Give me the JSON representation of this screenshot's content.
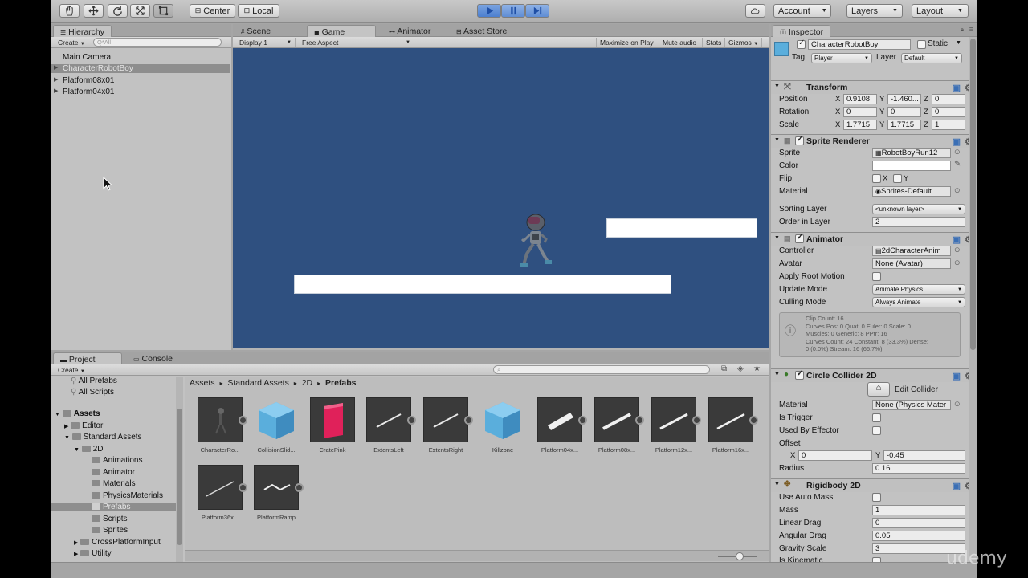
{
  "toolbar": {
    "center_label": "Center",
    "local_label": "Local",
    "account_label": "Account",
    "layers_label": "Layers",
    "layout_label": "Layout"
  },
  "hierarchy": {
    "tab_label": "Hierarchy",
    "create_label": "Create",
    "search_placeholder": "Q*All",
    "items": [
      {
        "label": "Main Camera"
      },
      {
        "label": "CharacterRobotBoy"
      },
      {
        "label": "Platform08x01"
      },
      {
        "label": "Platform04x01"
      }
    ]
  },
  "view_tabs": {
    "scene": "Scene",
    "game": "Game",
    "animator": "Animator",
    "asset_store": "Asset Store"
  },
  "game_bar": {
    "display": "Display 1",
    "aspect": "Free Aspect",
    "maximize": "Maximize on Play",
    "mute": "Mute audio",
    "stats": "Stats",
    "gizmos": "Gizmos"
  },
  "project": {
    "tab_label": "Project",
    "console_label": "Console",
    "create_label": "Create",
    "favorites": [
      {
        "label": "All Prefabs"
      },
      {
        "label": "All Scripts"
      }
    ],
    "tree": [
      {
        "label": "Assets"
      },
      {
        "label": "Editor"
      },
      {
        "label": "Standard Assets"
      },
      {
        "label": "2D"
      },
      {
        "label": "Animations"
      },
      {
        "label": "Animator"
      },
      {
        "label": "Materials"
      },
      {
        "label": "PhysicsMaterials"
      },
      {
        "label": "Prefabs"
      },
      {
        "label": "Scripts"
      },
      {
        "label": "Sprites"
      },
      {
        "label": "CrossPlatformInput"
      },
      {
        "label": "Utility"
      }
    ],
    "breadcrumb": [
      "Assets",
      "Standard Assets",
      "2D",
      "Prefabs"
    ],
    "assets": [
      {
        "label": "CharacterRo...",
        "icon": "robot-icon"
      },
      {
        "label": "CollisionSlid...",
        "icon": "cube-icon"
      },
      {
        "label": "CratePink",
        "icon": "crate-icon"
      },
      {
        "label": "ExtentsLeft",
        "icon": "line-icon"
      },
      {
        "label": "ExtentsRight",
        "icon": "line-icon"
      },
      {
        "label": "Killzone",
        "icon": "cube-icon"
      },
      {
        "label": "Platform04x...",
        "icon": "platform-icon"
      },
      {
        "label": "Platform08x...",
        "icon": "line-icon"
      },
      {
        "label": "Platform12x...",
        "icon": "line-icon"
      },
      {
        "label": "Platform16x...",
        "icon": "line-icon"
      },
      {
        "label": "Platform36x...",
        "icon": "line-icon"
      },
      {
        "label": "PlatformRamp",
        "icon": "ramp-icon"
      }
    ]
  },
  "inspector": {
    "tab_label": "Inspector",
    "object_name": "CharacterRobotBoy",
    "static_label": "Static",
    "tag_label": "Tag",
    "tag_value": "Player",
    "layer_label": "Layer",
    "layer_value": "Default",
    "transform": {
      "title": "Transform",
      "position_label": "Position",
      "position": {
        "x": "0.9108",
        "y": "-1.460...",
        "z": "0"
      },
      "rotation_label": "Rotation",
      "rotation": {
        "x": "0",
        "y": "0",
        "z": "0"
      },
      "scale_label": "Scale",
      "scale": {
        "x": "1.7715",
        "y": "1.7715",
        "z": "1"
      }
    },
    "sprite_renderer": {
      "title": "Sprite Renderer",
      "sprite_label": "Sprite",
      "sprite_value": "RobotBoyRun12",
      "color_label": "Color",
      "flip_label": "Flip",
      "flip_x": "X",
      "flip_y": "Y",
      "material_label": "Material",
      "material_value": "Sprites-Default",
      "sorting_layer_label": "Sorting Layer",
      "sorting_layer_value": "<unknown layer>",
      "order_label": "Order in Layer",
      "order_value": "2"
    },
    "animator": {
      "title": "Animator",
      "controller_label": "Controller",
      "controller_value": "2dCharacterAnim",
      "avatar_label": "Avatar",
      "avatar_value": "None (Avatar)",
      "root_motion_label": "Apply Root Motion",
      "update_mode_label": "Update Mode",
      "update_mode_value": "Animate Physics",
      "culling_mode_label": "Culling Mode",
      "culling_mode_value": "Always Animate",
      "info_lines": [
        "Clip Count: 16",
        "Curves Pos: 0 Quat: 0 Euler: 0 Scale: 0",
        "Muscles: 0 Generic: 8 PPtr: 16",
        "Curves Count: 24 Constant: 8 (33.3%) Dense:",
        "0 (0.0%) Stream: 16 (66.7%)"
      ]
    },
    "circle_collider": {
      "title": "Circle Collider 2D",
      "edit_label": "Edit Collider",
      "material_label": "Material",
      "material_value": "None (Physics Mater",
      "trigger_label": "Is Trigger",
      "effector_label": "Used By Effector",
      "offset_label": "Offset",
      "offset": {
        "x": "0",
        "y": "-0.45"
      },
      "radius_label": "Radius",
      "radius_value": "0.16"
    },
    "rigidbody": {
      "title": "Rigidbody 2D",
      "auto_mass_label": "Use Auto Mass",
      "mass_label": "Mass",
      "mass_value": "1",
      "linear_drag_label": "Linear Drag",
      "linear_drag_value": "0",
      "angular_drag_label": "Angular Drag",
      "angular_drag_value": "0.05",
      "gravity_label": "Gravity Scale",
      "gravity_value": "3",
      "kinematic_label": "Is Kinematic"
    }
  },
  "watermark": "udemy",
  "colors": {
    "game_bg": "#2f5080",
    "editor_bg": "#c2c2c2",
    "play_active": "#4c7fcf",
    "crate": "#e0215a",
    "cube": "#5aaedc"
  }
}
